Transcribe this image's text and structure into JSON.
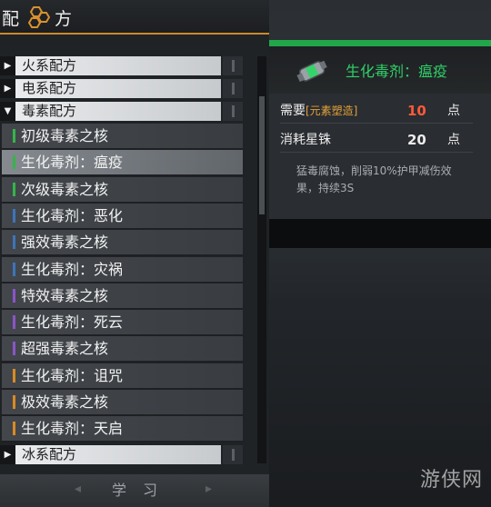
{
  "header": {
    "title_part1": "配",
    "title_part2": "方"
  },
  "categories": [
    {
      "label": "火系配方",
      "expanded": false
    },
    {
      "label": "电系配方",
      "expanded": false
    },
    {
      "label": "毒素配方",
      "expanded": true
    },
    {
      "label": "冰系配方",
      "expanded": false
    }
  ],
  "items": [
    {
      "label": "初级毒素之核",
      "color": "#35b54a"
    },
    {
      "label": "生化毒剂：瘟疫",
      "color": "#35b54a",
      "selected": true
    },
    {
      "label": "次级毒素之核",
      "color": "#35b54a"
    },
    {
      "label": "生化毒剂：恶化",
      "color": "#3f74b8"
    },
    {
      "label": "强效毒素之核",
      "color": "#3f74b8"
    },
    {
      "label": "生化毒剂：灾祸",
      "color": "#3f74b8"
    },
    {
      "label": "特效毒素之核",
      "color": "#8a55c6"
    },
    {
      "label": "生化毒剂：死云",
      "color": "#8a55c6"
    },
    {
      "label": "超强毒素之核",
      "color": "#8a55c6"
    },
    {
      "label": "生化毒剂：诅咒",
      "color": "#d88a24"
    },
    {
      "label": "极效毒素之核",
      "color": "#d88a24"
    },
    {
      "label": "生化毒剂：天启",
      "color": "#d88a24"
    }
  ],
  "learn_button": "学习",
  "detail": {
    "name": "生化毒剂：瘟疫",
    "require_label": "需要",
    "require_tag": "[元素塑造]",
    "require_value": "10",
    "require_unit": "点",
    "cost_label": "消耗星铢",
    "cost_value": "20",
    "cost_unit": "点",
    "description": "猛毒腐蚀，削弱10%护甲减伤效果，持续3S"
  },
  "colors": {
    "accent_orange": "#c98a2c",
    "accent_green": "#22a64a",
    "require_value": "#ff5a3a"
  },
  "watermark": "游侠网"
}
